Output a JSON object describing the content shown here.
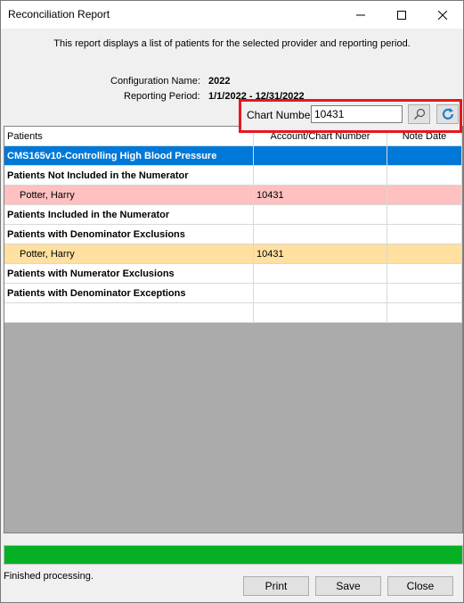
{
  "window": {
    "title": "Reconciliation Report"
  },
  "description": "This report displays a list of patients for the selected provider and reporting period.",
  "config": {
    "name_label": "Configuration Name:",
    "name_value": "2022",
    "period_label": "Reporting Period:",
    "period_value": "1/1/2022 - 12/31/2022"
  },
  "search": {
    "label": "Chart Number",
    "value": "10431"
  },
  "grid": {
    "headers": [
      "Patients",
      "Account/Chart Number",
      "Note Date"
    ],
    "rows": [
      {
        "c1": "CMS165v10-Controlling High Blood Pressure",
        "c2": "",
        "c3": ""
      },
      {
        "c1": "Patients Not Included in the Numerator",
        "c2": "",
        "c3": ""
      },
      {
        "c1": "Potter, Harry",
        "c2": "10431",
        "c3": ""
      },
      {
        "c1": "Patients Included in the Numerator",
        "c2": "",
        "c3": ""
      },
      {
        "c1": "Patients with Denominator Exclusions",
        "c2": "",
        "c3": ""
      },
      {
        "c1": "Potter, Harry",
        "c2": "10431",
        "c3": ""
      },
      {
        "c1": "Patients with Numerator Exclusions",
        "c2": "",
        "c3": ""
      },
      {
        "c1": "Patients with Denominator Exceptions",
        "c2": "",
        "c3": ""
      },
      {
        "c1": "",
        "c2": "",
        "c3": ""
      }
    ]
  },
  "progress": {
    "percent": 100,
    "color": "#06b025"
  },
  "status": "Finished processing.",
  "buttons": {
    "print": "Print",
    "save": "Save",
    "close": "Close"
  },
  "colors": {
    "selected": "#0078d7",
    "pink": "#ffc0c0",
    "orange": "#ffe0a0"
  }
}
